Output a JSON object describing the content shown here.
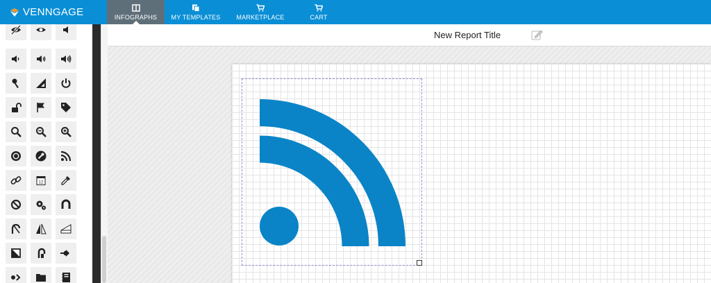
{
  "brand": {
    "name": "VENNGAGE",
    "accent": "#0a8fd6"
  },
  "nav": [
    {
      "label": "INFOGRAPHS",
      "icon": "book-icon",
      "active": true
    },
    {
      "label": "MY TEMPLATES",
      "icon": "copy-icon",
      "active": false
    },
    {
      "label": "MARKETPLACE",
      "icon": "cart-icon",
      "active": false
    },
    {
      "label": "CART",
      "icon": "cart-icon",
      "active": false
    }
  ],
  "document": {
    "title": "New Report Title",
    "edit_icon": "edit-icon"
  },
  "sidebar": {
    "icons": [
      "eye-off-icon",
      "eye-icon",
      "volume-off-icon",
      "volume-low-icon",
      "volume-mid-icon",
      "volume-high-icon",
      "key-icon",
      "triangle-ruler-icon",
      "power-icon",
      "unlock-icon",
      "flag-icon",
      "tag-icon",
      "search-icon",
      "zoom-out-icon",
      "zoom-in-icon",
      "gear-icon",
      "wrench-icon",
      "rss-icon",
      "link-icon",
      "calendar-icon",
      "eyedropper-icon",
      "ban-icon",
      "cogs-icon",
      "magnet-icon",
      "fork-icon",
      "flip-icon",
      "ruler-icon",
      "crop-icon",
      "hand-icon",
      "arrow-right-icon",
      "login-icon",
      "folder-icon",
      "notebook-icon"
    ],
    "calendar_day": "12"
  },
  "canvas": {
    "selected_element": "rss-icon",
    "element_color": "#0a84c6"
  }
}
